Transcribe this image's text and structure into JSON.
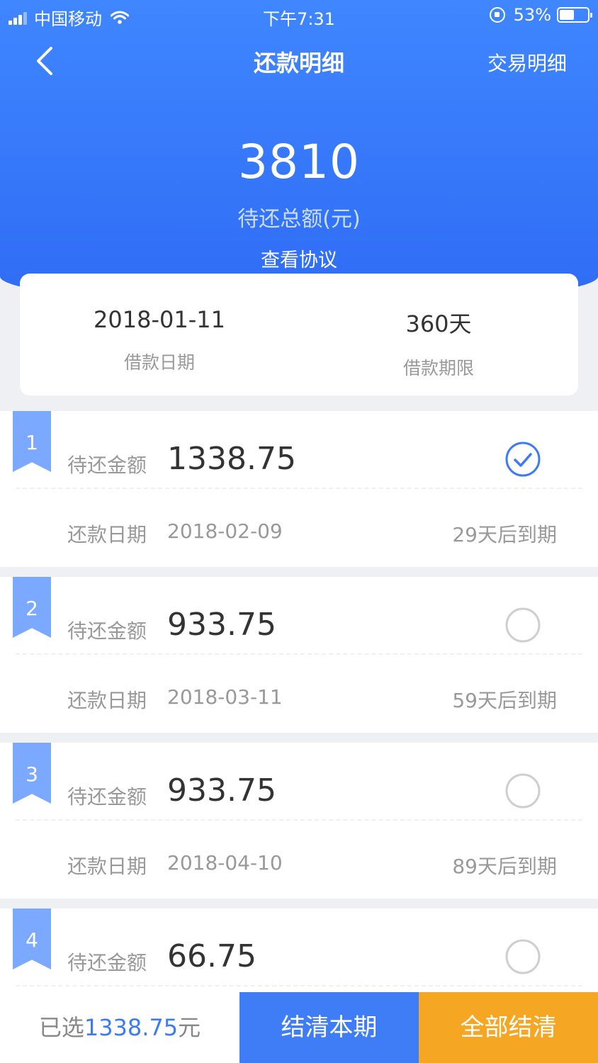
{
  "status_bar": {
    "carrier": "中国移动",
    "time": "下午7:31",
    "battery": "53%",
    "battery_level": 0.53,
    "icons": [
      "signal-icon",
      "wifi-icon",
      "rotation-lock-icon",
      "battery-icon"
    ]
  },
  "navbar": {
    "back_icon": "chevron-left-icon",
    "title": "还款明细",
    "right_link": "交易明细"
  },
  "summary": {
    "total": "3810",
    "total_label": "待还总额(元)",
    "agreement_link": "查看协议"
  },
  "loan_info": {
    "date_value": "2018-01-11",
    "date_label": "借款日期",
    "term_value": "360天",
    "term_label": "借款期限"
  },
  "installments": [
    {
      "index": "1",
      "amount_label": "待还金额",
      "amount": "1338.75",
      "date_label": "还款日期",
      "date": "2018-02-09",
      "due": "29天后到期",
      "selected": true
    },
    {
      "index": "2",
      "amount_label": "待还金额",
      "amount": "933.75",
      "date_label": "还款日期",
      "date": "2018-03-11",
      "due": "59天后到期",
      "selected": false
    },
    {
      "index": "3",
      "amount_label": "待还金额",
      "amount": "933.75",
      "date_label": "还款日期",
      "date": "2018-04-10",
      "due": "89天后到期",
      "selected": false
    },
    {
      "index": "4",
      "amount_label": "待还金额",
      "amount": "66.75",
      "selected": false
    }
  ],
  "bottom_bar": {
    "selected_prefix": "已选",
    "selected_amount": "1338.75",
    "selected_suffix": "元",
    "settle_period": "结清本期",
    "settle_all": "全部结清"
  },
  "colors": {
    "primary": "#3f7df6",
    "accent": "#f5a623",
    "ribbon": "#7ba9ff"
  }
}
